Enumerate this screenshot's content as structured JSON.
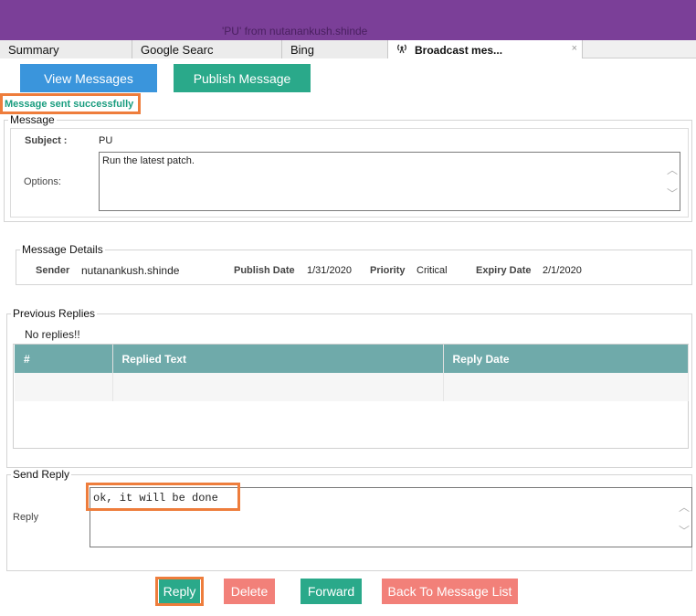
{
  "window": {
    "title": "'PU' from nutanankush.shinde"
  },
  "tabs": [
    {
      "label": "Summary"
    },
    {
      "label": "Google Searc"
    },
    {
      "label": "Bing"
    },
    {
      "label": "Broadcast mes...",
      "icon": "broadcast-icon",
      "close": "×"
    }
  ],
  "toolbar": {
    "view_label": "View Messages",
    "publish_label": "Publish Message"
  },
  "status": "Message sent successfully",
  "message": {
    "legend": "Message",
    "subject_label": "Subject :",
    "subject": "PU",
    "options_label": "Options:",
    "body": "Run the latest patch."
  },
  "details": {
    "legend": "Message Details",
    "sender_label": "Sender",
    "sender": "nutanankush.shinde",
    "publish_label": "Publish Date",
    "publish_date": "1/31/2020",
    "priority_label": "Priority",
    "priority": "Critical",
    "expiry_label": "Expiry Date",
    "expiry_date": "2/1/2020"
  },
  "previous": {
    "legend": "Previous Replies",
    "empty_text": "No replies!!",
    "columns": [
      "#",
      "Replied Text",
      "Reply Date"
    ]
  },
  "send": {
    "legend": "Send Reply",
    "reply_label": "Reply",
    "reply_value": "ok, it will be done"
  },
  "actions": {
    "reply": "Reply",
    "delete": "Delete",
    "forward": "Forward",
    "back": "Back To Message List"
  },
  "colors": {
    "titlebar": "#7b3f98",
    "blue": "#3a95dc",
    "green": "#2aa98a",
    "salmon": "#f28079",
    "table_header": "#6faaaa",
    "highlight": "#ee7d3c"
  }
}
